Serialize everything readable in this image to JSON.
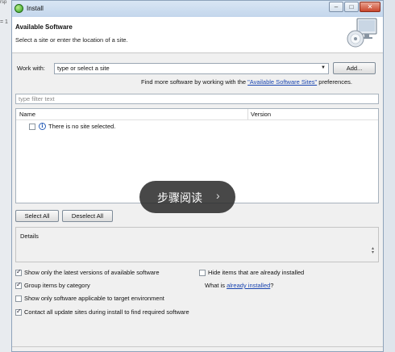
{
  "background_window": {
    "fragment_top": "rsp",
    "fragment_mid": "= 1"
  },
  "window": {
    "title": "Install",
    "controls": {
      "minimize": "–",
      "maximize": "□",
      "close": "✕"
    }
  },
  "header": {
    "title": "Available Software",
    "subtitle": "Select a site or enter the location of a site."
  },
  "work_with": {
    "label": "Work with:",
    "value": "type or select a site",
    "add_button": "Add...",
    "more_prefix": "Find more software by working with the ",
    "more_link": "\"Available Software Sites\"",
    "more_suffix": " preferences."
  },
  "filter": {
    "placeholder": "type filter text"
  },
  "table": {
    "columns": [
      "Name",
      "Version"
    ],
    "rows": [
      {
        "text": "There is no site selected."
      }
    ]
  },
  "buttons": {
    "select_all": "Select All",
    "deselect_all": "Deselect All"
  },
  "details": {
    "label": "Details"
  },
  "options": {
    "show_latest": {
      "label": "Show only the latest versions of available software",
      "checked": true
    },
    "hide_installed": {
      "label": "Hide items that are already installed",
      "checked": false
    },
    "group_by_category": {
      "label": "Group items by category",
      "checked": true
    },
    "what_is": {
      "prefix": "What is ",
      "link": "already installed",
      "suffix": "?"
    },
    "applicable_only": {
      "label": "Show only software applicable to target environment",
      "checked": false
    },
    "contact_sites": {
      "label": "Contact all update sites during install to find required software",
      "checked": true
    }
  },
  "overlay": {
    "label": "步骤阅读",
    "arrow": "›"
  }
}
